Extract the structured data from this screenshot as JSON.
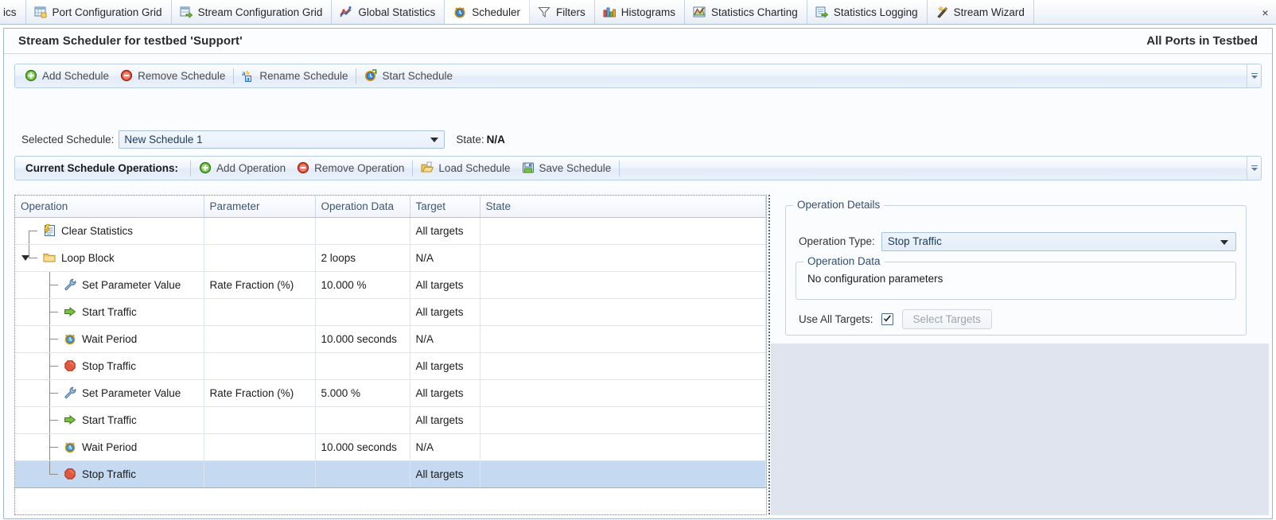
{
  "tabs": [
    {
      "label": "ics",
      "icon": "",
      "active": false,
      "clipped": true
    },
    {
      "label": "Port Configuration Grid",
      "icon": "grid-icon",
      "active": false
    },
    {
      "label": "Stream Configuration Grid",
      "icon": "stream-grid-icon",
      "active": false
    },
    {
      "label": "Global Statistics",
      "icon": "statistics-icon",
      "active": false
    },
    {
      "label": "Scheduler",
      "icon": "clock-icon",
      "active": true
    },
    {
      "label": "Filters",
      "icon": "funnel-icon",
      "active": false
    },
    {
      "label": "Histograms",
      "icon": "histogram-icon",
      "active": false
    },
    {
      "label": "Statistics Charting",
      "icon": "chart-icon",
      "active": false
    },
    {
      "label": "Statistics Logging",
      "icon": "logging-icon",
      "active": false
    },
    {
      "label": "Stream Wizard",
      "icon": "wand-icon",
      "active": false
    }
  ],
  "tab_close_label": "×",
  "header": {
    "title": "Stream Scheduler for testbed 'Support'",
    "scope": "All Ports in Testbed"
  },
  "schedule_toolbar": {
    "items": [
      {
        "label": "Add Schedule",
        "icon": "add-green-circle-icon",
        "sep_after": false
      },
      {
        "label": "Remove Schedule",
        "icon": "remove-red-circle-icon",
        "sep_after": true
      },
      {
        "label": "Rename Schedule",
        "icon": "rename-ab-icon",
        "sep_after": true
      },
      {
        "label": "Start Schedule",
        "icon": "start-clock-icon",
        "sep_after": false
      }
    ]
  },
  "selected_schedule": {
    "label": "Selected Schedule:",
    "value": "New Schedule 1",
    "state_label": "State:",
    "state_value": "N/A"
  },
  "operations_toolbar": {
    "title": "Current Schedule Operations:",
    "items": [
      {
        "label": "Add Operation",
        "icon": "add-green-circle-icon",
        "sep_after": false
      },
      {
        "label": "Remove Operation",
        "icon": "remove-red-circle-icon",
        "sep_after": true
      },
      {
        "label": "Load Schedule",
        "icon": "open-folder-icon",
        "sep_after": false
      },
      {
        "label": "Save Schedule",
        "icon": "floppy-save-icon",
        "sep_after": true
      }
    ]
  },
  "grid": {
    "columns": [
      "Operation",
      "Parameter",
      "Operation Data",
      "Target",
      "State"
    ],
    "rows": [
      {
        "operation": "Clear Statistics",
        "parameter": "",
        "operation_data": "",
        "target": "All targets",
        "state": "",
        "depth": 1,
        "icon": "clear-statistics-icon",
        "expander": "none",
        "selected": false,
        "last_child": false
      },
      {
        "operation": "Loop Block",
        "parameter": "",
        "operation_data": "2 loops",
        "target": "N/A",
        "state": "",
        "depth": 1,
        "icon": "folder-icon",
        "expander": "open",
        "selected": false,
        "last_child": true
      },
      {
        "operation": "Set Parameter Value",
        "parameter": "Rate Fraction (%)",
        "operation_data": "10.000 %",
        "target": "All targets",
        "state": "",
        "depth": 2,
        "icon": "wrench-icon",
        "expander": "none",
        "selected": false,
        "last_child": false
      },
      {
        "operation": "Start Traffic",
        "parameter": "",
        "operation_data": "",
        "target": "All targets",
        "state": "",
        "depth": 2,
        "icon": "green-arrow-icon",
        "expander": "none",
        "selected": false,
        "last_child": false
      },
      {
        "operation": "Wait Period",
        "parameter": "",
        "operation_data": "10.000 seconds",
        "target": "N/A",
        "state": "",
        "depth": 2,
        "icon": "alarm-clock-icon",
        "expander": "none",
        "selected": false,
        "last_child": false
      },
      {
        "operation": "Stop Traffic",
        "parameter": "",
        "operation_data": "",
        "target": "All targets",
        "state": "",
        "depth": 2,
        "icon": "red-stop-icon",
        "expander": "none",
        "selected": false,
        "last_child": false
      },
      {
        "operation": "Set Parameter Value",
        "parameter": "Rate Fraction (%)",
        "operation_data": "5.000 %",
        "target": "All targets",
        "state": "",
        "depth": 2,
        "icon": "wrench-icon",
        "expander": "none",
        "selected": false,
        "last_child": false
      },
      {
        "operation": "Start Traffic",
        "parameter": "",
        "operation_data": "",
        "target": "All targets",
        "state": "",
        "depth": 2,
        "icon": "green-arrow-icon",
        "expander": "none",
        "selected": false,
        "last_child": false
      },
      {
        "operation": "Wait Period",
        "parameter": "",
        "operation_data": "10.000 seconds",
        "target": "N/A",
        "state": "",
        "depth": 2,
        "icon": "alarm-clock-icon",
        "expander": "none",
        "selected": false,
        "last_child": false
      },
      {
        "operation": "Stop Traffic",
        "parameter": "",
        "operation_data": "",
        "target": "All targets",
        "state": "",
        "depth": 2,
        "icon": "red-stop-icon",
        "expander": "none",
        "selected": true,
        "last_child": true
      }
    ]
  },
  "details": {
    "group_title": "Operation Details",
    "operation_type_label": "Operation Type:",
    "operation_type_value": "Stop Traffic",
    "operation_data_group": "Operation Data",
    "operation_data_text": "No configuration parameters",
    "use_all_targets_label": "Use All Targets:",
    "use_all_targets_checked": true,
    "select_targets_label": "Select Targets"
  },
  "colors": {
    "accent_blue": "#3b5777",
    "selection": "#c5d9f1",
    "panel_border": "#9fb6cf",
    "toolbar_border": "#b9cde3",
    "details_bg": "#dfe4ef",
    "green": "#4a9a2e",
    "red": "#d8452f",
    "folder": "#f0c060"
  }
}
